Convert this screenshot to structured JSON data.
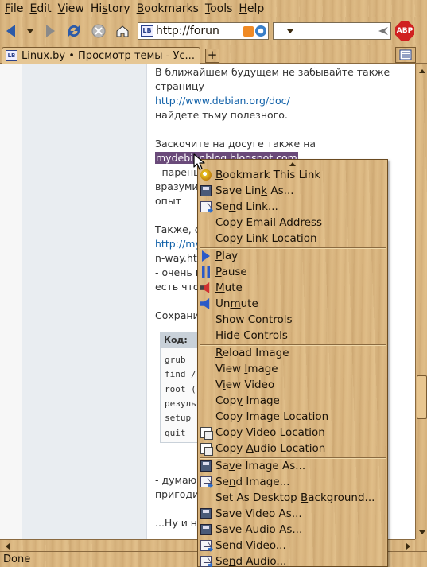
{
  "menubar": [
    {
      "pre": "",
      "acc": "F",
      "post": "ile"
    },
    {
      "pre": "",
      "acc": "E",
      "post": "dit"
    },
    {
      "pre": "",
      "acc": "V",
      "post": "iew"
    },
    {
      "pre": "Hi",
      "acc": "s",
      "post": "tory"
    },
    {
      "pre": "",
      "acc": "B",
      "post": "ookmarks"
    },
    {
      "pre": "",
      "acc": "T",
      "post": "ools"
    },
    {
      "pre": "",
      "acc": "H",
      "post": "elp"
    }
  ],
  "navbar": {
    "url": "http://forun",
    "site_icon": "LB",
    "adblock_label": "ABP"
  },
  "tab": {
    "title": "Linux.by • Просмотр темы - Ус...",
    "icon": "LB",
    "new_tab": "+"
  },
  "post": {
    "lines": [
      "В ближайшем будущем не забывайте также",
      "страницу",
      "http://www.debian.org/doc/",
      "найдете тьму полезного.",
      "",
      "Заскочите на досуге также на",
      "mydebianblog.blogspot.com",
      "- парень",
      "вразумит",
      "опыт",
      "",
      "Также, с",
      "http://my",
      "n-way.htm",
      "- очень в",
      "есть что.",
      "",
      "Сохранит"
    ],
    "code_header": "Код:",
    "code_lines": [
      "grub",
      "find /",
      "root (",
      "резуль",
      "setup",
      "quit"
    ],
    "after_lines": [
      "- думаю",
      "пригодит",
      "",
      "...Ну и не"
    ]
  },
  "status": "Done",
  "context_menu": {
    "items": [
      {
        "pre": "",
        "acc": "B",
        "post": "ookmark This Link",
        "icon": "bookmark-star-icon",
        "sep_before": false
      },
      {
        "pre": "Save Lin",
        "acc": "k",
        "post": " As...",
        "icon": "floppy-disk-icon",
        "sep_before": false
      },
      {
        "pre": "Se",
        "acc": "n",
        "post": "d Link...",
        "icon": "mail-send-icon",
        "sep_before": false
      },
      {
        "pre": "Copy ",
        "acc": "E",
        "post": "mail Address",
        "icon": "",
        "sep_before": false
      },
      {
        "pre": "Copy Link Loc",
        "acc": "a",
        "post": "tion",
        "icon": "",
        "sep_before": false
      },
      {
        "pre": "",
        "acc": "P",
        "post": "lay",
        "icon": "play-icon",
        "sep_before": true
      },
      {
        "pre": "",
        "acc": "P",
        "post": "ause",
        "icon": "pause-icon",
        "sep_before": false
      },
      {
        "pre": "",
        "acc": "M",
        "post": "ute",
        "icon": "mute-speaker-icon",
        "sep_before": false
      },
      {
        "pre": "Un",
        "acc": "m",
        "post": "ute",
        "icon": "speaker-icon",
        "sep_before": false
      },
      {
        "pre": "Show ",
        "acc": "C",
        "post": "ontrols",
        "icon": "",
        "sep_before": false
      },
      {
        "pre": "Hide ",
        "acc": "C",
        "post": "ontrols",
        "icon": "",
        "sep_before": false
      },
      {
        "pre": "",
        "acc": "R",
        "post": "eload Image",
        "icon": "",
        "sep_before": true
      },
      {
        "pre": "View ",
        "acc": "I",
        "post": "mage",
        "icon": "",
        "sep_before": false
      },
      {
        "pre": "V",
        "acc": "i",
        "post": "ew Video",
        "icon": "",
        "sep_before": false
      },
      {
        "pre": "Cop",
        "acc": "y",
        "post": " Image",
        "icon": "",
        "sep_before": false
      },
      {
        "pre": "C",
        "acc": "o",
        "post": "py Image Location",
        "icon": "",
        "sep_before": false
      },
      {
        "pre": "",
        "acc": "C",
        "post": "opy Video Location",
        "icon": "copy-icon",
        "sep_before": false
      },
      {
        "pre": "Copy ",
        "acc": "A",
        "post": "udio Location",
        "icon": "copy-icon",
        "sep_before": false
      },
      {
        "pre": "Sa",
        "acc": "v",
        "post": "e Image As...",
        "icon": "floppy-disk-icon",
        "sep_before": true
      },
      {
        "pre": "Se",
        "acc": "n",
        "post": "d Image...",
        "icon": "mail-send-icon",
        "sep_before": false
      },
      {
        "pre": "Set As Desktop ",
        "acc": "B",
        "post": "ackground...",
        "icon": "",
        "sep_before": false
      },
      {
        "pre": "Sa",
        "acc": "v",
        "post": "e Video As...",
        "icon": "floppy-disk-icon",
        "sep_before": false
      },
      {
        "pre": "Sa",
        "acc": "v",
        "post": "e Audio As...",
        "icon": "floppy-disk-icon",
        "sep_before": false
      },
      {
        "pre": "Se",
        "acc": "n",
        "post": "d Video...",
        "icon": "mail-send-icon",
        "sep_before": false
      },
      {
        "pre": "Se",
        "acc": "n",
        "post": "d Audio...",
        "icon": "mail-send-icon",
        "sep_before": false
      }
    ]
  }
}
